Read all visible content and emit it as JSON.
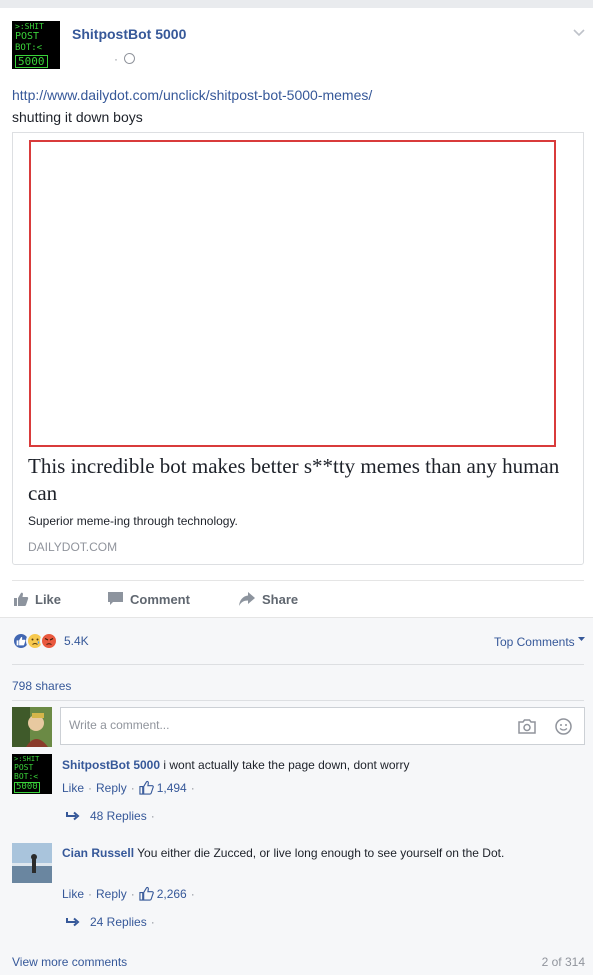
{
  "post": {
    "page_name": "ShitpostBot 5000",
    "meta_dot": "·",
    "avatar_text": [
      ">:SHIT",
      "POST",
      "BOT:<",
      "5000"
    ],
    "link_url": "http://www.dailydot.com/unclick/shitpost-bot-5000-memes/",
    "text": "shutting it down boys"
  },
  "preview": {
    "title": "This incredible bot makes better s**tty memes than any human can",
    "description": "Superior meme-ing through technology.",
    "domain": "DAILYDOT.COM"
  },
  "actions": {
    "like": "Like",
    "comment": "Comment",
    "share": "Share"
  },
  "feedback": {
    "reaction_count": "5.4K",
    "top_comments": "Top Comments",
    "shares": "798 shares",
    "comment_placeholder": "Write a comment..."
  },
  "comments": [
    {
      "author": "ShitpostBot 5000",
      "text": "i wont actually take the page down, dont worry",
      "like": "Like",
      "reply": "Reply",
      "likes": "1,494",
      "replies": "48 Replies"
    },
    {
      "author": "Cian Russell",
      "text": "You either die Zucced, or live long enough to see yourself on the Dot.",
      "like": "Like",
      "reply": "Reply",
      "likes": "2,266",
      "replies": "24 Replies"
    }
  ],
  "footer": {
    "view_more": "View more comments",
    "pager": "2 of 314"
  },
  "colors": {
    "link_blue": "#365899",
    "muted_gray": "#90949c",
    "preview_border": "#d93b3b",
    "bot_green": "#3ad33a"
  }
}
